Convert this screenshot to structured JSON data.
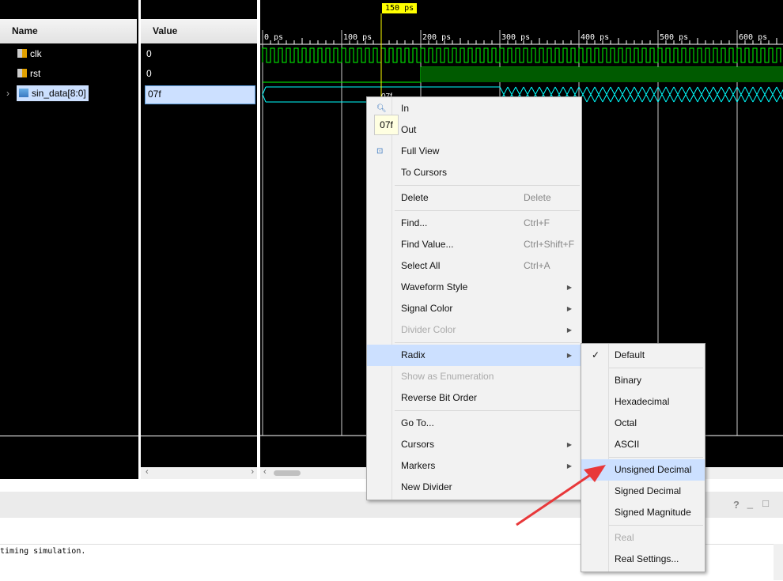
{
  "columns": {
    "name": "Name",
    "value": "Value"
  },
  "signals": [
    {
      "name": "clk",
      "value": "0",
      "icon": "signal-lock-icon"
    },
    {
      "name": "rst",
      "value": "0",
      "icon": "signal-lock-icon"
    },
    {
      "name": "sin_data[8:0]",
      "value": "07f",
      "icon": "bus-icon",
      "expandable": true,
      "selected": true
    }
  ],
  "timeline": {
    "cursor_label": "150 ps",
    "ticks": [
      "0 ps",
      "100 ps",
      "200 ps",
      "300 ps",
      "400 ps",
      "500 ps",
      "600 ps"
    ],
    "bus_label": "07f"
  },
  "colors": {
    "wave": "#00ff00",
    "bus": "#00ffff",
    "cursor": "#ffff00",
    "menu_highlight": "#cce0ff"
  },
  "tooltip": "07f",
  "context_menu": [
    {
      "label": "In",
      "icon": "zoom-in-icon"
    },
    {
      "label": "Out",
      "icon": "zoom-out-icon"
    },
    {
      "label": "Full View",
      "icon": "zoom-fit-icon"
    },
    {
      "label": "To Cursors"
    },
    {
      "sep": true
    },
    {
      "label": "Delete",
      "shortcut": "Delete"
    },
    {
      "sep": true
    },
    {
      "label": "Find...",
      "shortcut": "Ctrl+F"
    },
    {
      "label": "Find Value...",
      "shortcut": "Ctrl+Shift+F"
    },
    {
      "label": "Select All",
      "shortcut": "Ctrl+A"
    },
    {
      "label": "Waveform Style",
      "submenu": true
    },
    {
      "label": "Signal Color",
      "submenu": true
    },
    {
      "label": "Divider Color",
      "submenu": true,
      "disabled": true
    },
    {
      "sep": true
    },
    {
      "label": "Radix",
      "submenu": true,
      "highlighted": true
    },
    {
      "label": "Show as Enumeration",
      "disabled": true
    },
    {
      "label": "Reverse Bit Order"
    },
    {
      "sep": true
    },
    {
      "label": "Go To..."
    },
    {
      "label": "Cursors",
      "submenu": true
    },
    {
      "label": "Markers",
      "submenu": true
    },
    {
      "label": "New Divider"
    }
  ],
  "radix_menu": [
    {
      "label": "Default",
      "checked": true
    },
    {
      "sep": true
    },
    {
      "label": "Binary"
    },
    {
      "label": "Hexadecimal"
    },
    {
      "label": "Octal"
    },
    {
      "label": "ASCII"
    },
    {
      "sep": true
    },
    {
      "label": "Unsigned Decimal",
      "highlighted": true
    },
    {
      "label": "Signed Decimal"
    },
    {
      "label": "Signed Magnitude"
    },
    {
      "sep": true
    },
    {
      "label": "Real",
      "disabled": true
    },
    {
      "label": "Real Settings..."
    }
  ],
  "panel_controls": {
    "help": "?",
    "minimize": "_",
    "restore": "□"
  },
  "console": {
    "text": "timing simulation."
  }
}
